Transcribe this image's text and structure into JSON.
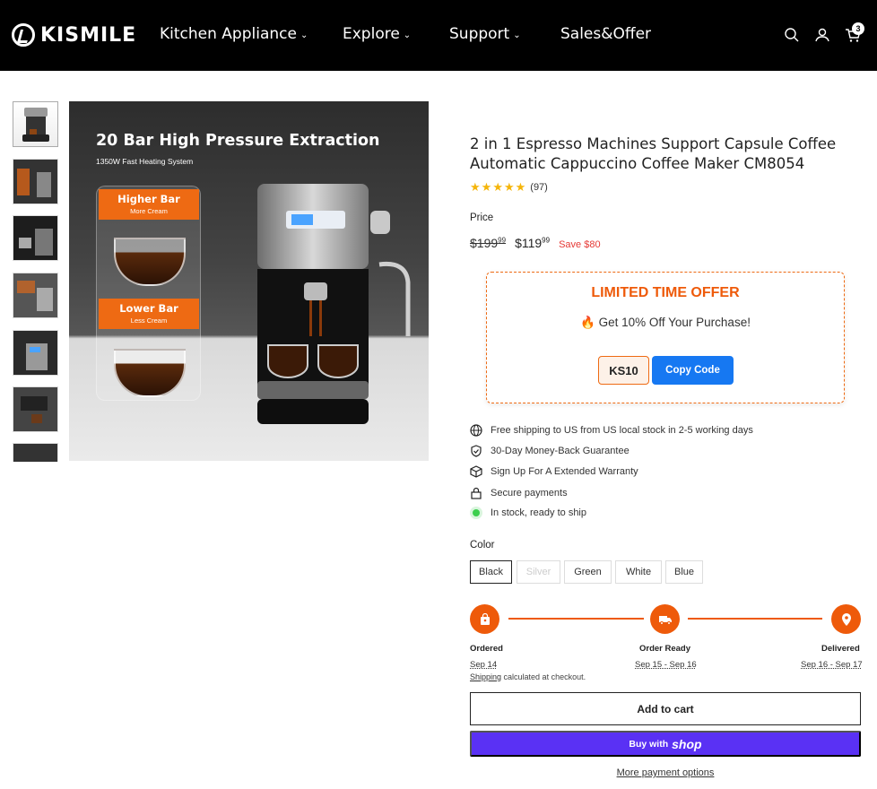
{
  "header": {
    "logo_text": "KISMILE",
    "nav": [
      {
        "label": "Kitchen Appliance"
      },
      {
        "label": "Explore"
      },
      {
        "label": "Support"
      },
      {
        "label": "Sales&Offer"
      }
    ],
    "cart_count": "3"
  },
  "gallery": {
    "main_image": {
      "headline": "20 Bar High Pressure Extraction",
      "subline": "1350W  Fast Heating System",
      "higher_bar": "Higher Bar",
      "higher_sub": "More Cream",
      "lower_bar": "Lower Bar",
      "lower_sub": "Less Cream"
    }
  },
  "product": {
    "title": "2 in 1 Espresso Machines Support Capsule Coffee Automatic Cappuccino Coffee Maker CM8054",
    "rating_count": "(97)",
    "price_label": "Price",
    "old_price": "$199",
    "old_cents": "99",
    "new_price": "$119",
    "new_cents": "99",
    "save": "Save $80"
  },
  "offer": {
    "heading": "LIMITED TIME OFFER",
    "subtitle": "🔥 Get 10% Off Your Purchase!",
    "code": "KS10",
    "copy_label": "Copy Code"
  },
  "features": [
    "Free shipping to US from US local stock in 2-5 working days",
    "30-Day Money-Back Guarantee",
    "Sign Up For A Extended Warranty",
    "Secure payments",
    "In stock, ready to ship"
  ],
  "color": {
    "label": "Color",
    "options": [
      "Black",
      "Silver",
      "Green",
      "White",
      "Blue"
    ],
    "selected": "Black"
  },
  "timeline": {
    "steps": [
      {
        "label": "Ordered",
        "date": "Sep 14"
      },
      {
        "label": "Order Ready",
        "date": "Sep 15 - Sep 16"
      },
      {
        "label": "Delivered",
        "date": "Sep 16 - Sep 17"
      }
    ],
    "shipping_link": "Shipping",
    "shipping_note": " calculated at checkout."
  },
  "actions": {
    "add_to_cart": "Add to cart",
    "buy_with": "Buy with",
    "shop": "shop",
    "more_options": "More payment options"
  },
  "colors": {
    "accent": "#ee5a0a",
    "shop_purple": "#5a31f4",
    "copy_blue": "#1678f2"
  }
}
